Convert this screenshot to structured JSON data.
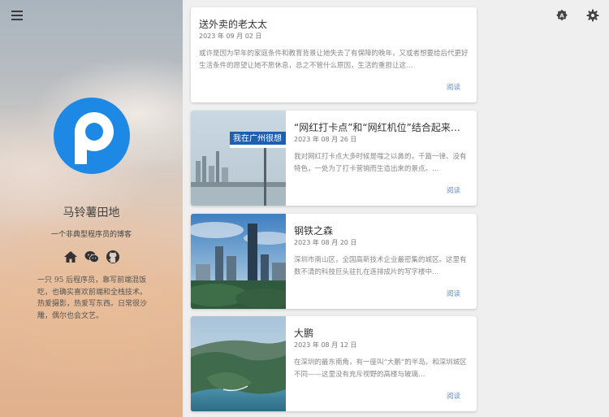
{
  "sidebar": {
    "site_title": "马铃薯田地",
    "site_subtitle": "一个非典型程序员的博客",
    "bio": "一只 95 后程序员，靠写前端混饭吃，也确实喜欢前端和全栈技术。热爱摄影，热爱写东西。日常很沙雕，偶尔也会文艺。",
    "social_icons": [
      "home-icon",
      "wechat-icon",
      "github-icon"
    ]
  },
  "posts": [
    {
      "title": "送外卖的老太太",
      "date": "2023 年 09 月 02 日",
      "excerpt": "或许是因为早年的家庭条件和教育背景让她失去了有保障的晚年，又或者想要给后代更好生活条件的愿望让她不愿休息，总之不管什么原因，生活的重担让这…",
      "read_label": "阅读"
    },
    {
      "title": "“网红打卡点”和“网红机位”结合起来的…",
      "date": "2023 年 08 月 26 日",
      "excerpt": "我对网红打卡点大多时候是嗤之以鼻的，千篇一律、没有特色，一处为了打卡营销而生造出来的景点。…",
      "read_label": "阅读",
      "image_sign": "我在广州很想"
    },
    {
      "title": "钢铁之森",
      "date": "2023 年 08 月 20 日",
      "excerpt": "深圳市南山区，全国高新技术企业最密集的城区。这里有数不清的科技巨头驻扎在连排成片的写字楼中…",
      "read_label": "阅读"
    },
    {
      "title": "大鹏",
      "date": "2023 年 08 月 12 日",
      "excerpt": "在深圳的最东南角，有一座叫“大鹏”的半岛。和深圳城区不同——这里没有充斥视野的高楼与玻璃…",
      "read_label": "阅读"
    }
  ],
  "colors": {
    "accent": "#5b8fd0",
    "logo_blue": "#1e88e5"
  }
}
